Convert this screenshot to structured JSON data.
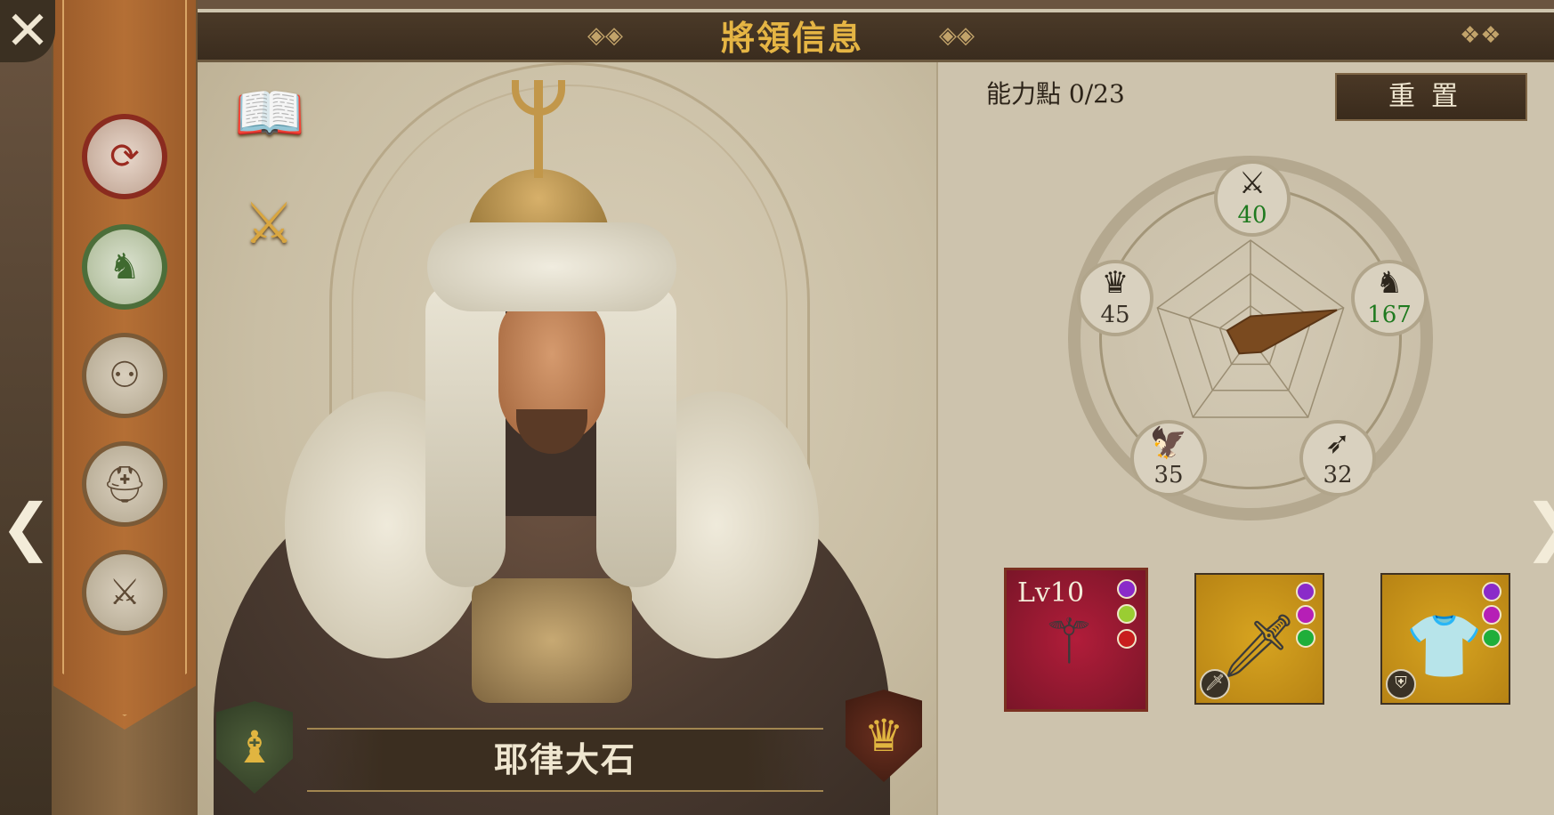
{
  "header": {
    "title": "將領信息"
  },
  "window": {
    "close_glyph": "✕"
  },
  "side_menu": {
    "items": [
      {
        "icon": "swap-commanders-icon",
        "glyph": "⟳",
        "state": "red"
      },
      {
        "icon": "knight-sword-icon",
        "glyph": "♞",
        "state": "selected"
      },
      {
        "icon": "troops-group-icon",
        "glyph": "⚇",
        "state": "inactive"
      },
      {
        "icon": "helmet-icon",
        "glyph": "⛑",
        "state": "inactive"
      },
      {
        "icon": "upgrade-sword-icon",
        "glyph": "⚔",
        "state": "inactive"
      }
    ]
  },
  "features": {
    "bio_icon": "book-quill-icon",
    "bio_glyph": "📖",
    "skills_icon": "shield-crossed-swords-icon",
    "skills_glyph": "⚔"
  },
  "hero": {
    "name": "耶律大石",
    "rank_icon": "bishop-chess-icon",
    "rank_glyph": "♝",
    "class_icon": "crown-icon",
    "class_glyph": "♛"
  },
  "nav": {
    "prev_glyph": "❮",
    "next_glyph": "❯"
  },
  "stats": {
    "ability_points_label": "能力點 0/23",
    "reset_label": "重置",
    "attributes": [
      {
        "icon": "crossed-swords-icon",
        "glyph": "⚔",
        "value": "40",
        "highlight": true
      },
      {
        "icon": "knight-icon",
        "glyph": "♞",
        "value": "167",
        "highlight": true
      },
      {
        "icon": "bow-icon",
        "glyph": "➶",
        "value": "32",
        "highlight": false
      },
      {
        "icon": "eagle-icon",
        "glyph": "🦅",
        "value": "35",
        "highlight": false
      },
      {
        "icon": "crown-icon",
        "glyph": "♛",
        "value": "45",
        "highlight": false
      }
    ],
    "radar_values": [
      40,
      167,
      32,
      35,
      45
    ],
    "radar_max": 180
  },
  "equipment": [
    {
      "name": "mace-weapon",
      "level": "Lv10",
      "glyph": "⚚",
      "rarity_color": "#a8162f",
      "gems": [
        "#8a2bc9",
        "#9acd32",
        "#c81e1e"
      ],
      "badge_glyph": ""
    },
    {
      "name": "sword-weapon",
      "level": "",
      "glyph": "🗡",
      "rarity_color": "#c99817",
      "gems": [
        "#8a2bc9",
        "#b61fb6",
        "#1fae3a"
      ],
      "badge_glyph": "🗡"
    },
    {
      "name": "chainmail-armor",
      "level": "",
      "glyph": "👕",
      "rarity_color": "#c99817",
      "gems": [
        "#8a2bc9",
        "#b61fb6",
        "#1fae3a"
      ],
      "badge_glyph": "⛨"
    }
  ],
  "colors": {
    "title_gold": "#e5b544",
    "stat_green": "#1f7a1f",
    "radar_fill": "#7a4a1f"
  }
}
